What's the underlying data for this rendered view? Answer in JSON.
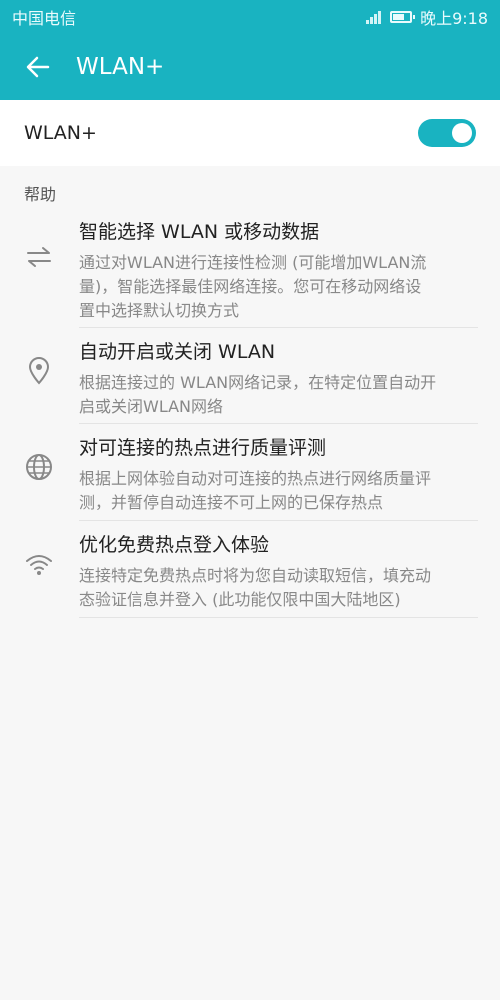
{
  "status_bar": {
    "carrier": "中国电信",
    "time": "晚上9:18",
    "battery_percent": 70
  },
  "header": {
    "title": "WLAN+",
    "back_icon": "back-arrow-icon",
    "bg_color": "#19b3c1"
  },
  "toggle_row": {
    "label": "WLAN+",
    "enabled": true
  },
  "section": {
    "title": "帮助"
  },
  "help_items": [
    {
      "icon": "swap-arrows-icon",
      "title": "智能选择 WLAN 或移动数据",
      "desc_lines": [
        "通过对WLAN进行连接性检测 (可能增加WLAN流",
        "量)，智能选择最佳网络连接。您可在移动网络设",
        "置中选择默认切换方式"
      ]
    },
    {
      "icon": "location-pin-icon",
      "title": "自动开启或关闭 WLAN",
      "desc_lines": [
        "根据连接过的 WLAN网络记录，在特定位置自动开",
        "启或关闭WLAN网络"
      ]
    },
    {
      "icon": "globe-icon",
      "title": "对可连接的热点进行质量评测",
      "desc_lines": [
        "根据上网体验自动对可连接的热点进行网络质量评",
        "测，并暂停自动连接不可上网的已保存热点"
      ]
    },
    {
      "icon": "wifi-icon",
      "title": "优化免费热点登入体验",
      "desc_lines": [
        "连接特定免费热点时将为您自动读取短信，填充动",
        "态验证信息并登入 (此功能仅限中国大陆地区)"
      ]
    }
  ]
}
